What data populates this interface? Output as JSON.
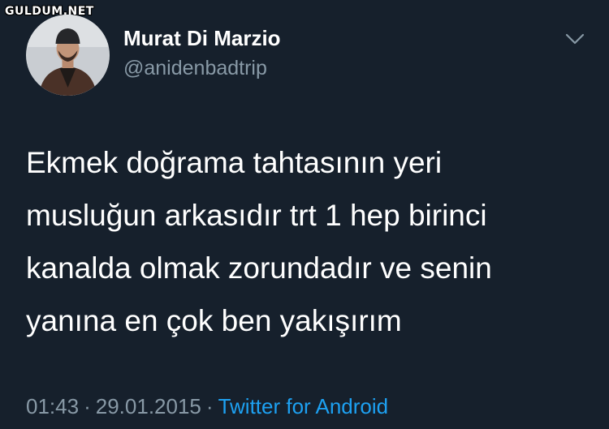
{
  "watermark": "GULDUM.NET",
  "user": {
    "name": "Murat Di Marzio",
    "handle": "@anidenbadtrip"
  },
  "tweet": {
    "lines": [
      "Ekmek doğrama tahtasının yeri",
      "musluğun arkasıdır trt 1 hep birinci",
      "kanalda olmak zorundadır ve senin",
      "yanına en çok ben yakışırım"
    ]
  },
  "meta": {
    "time": "01:43",
    "separator": "·",
    "date": "29.01.2015",
    "source": "Twitter for Android"
  },
  "colors": {
    "background": "#16202c",
    "secondary_text": "#8899a6",
    "link": "#1da1f2"
  },
  "icons": {
    "options": "chevron-down-icon"
  }
}
